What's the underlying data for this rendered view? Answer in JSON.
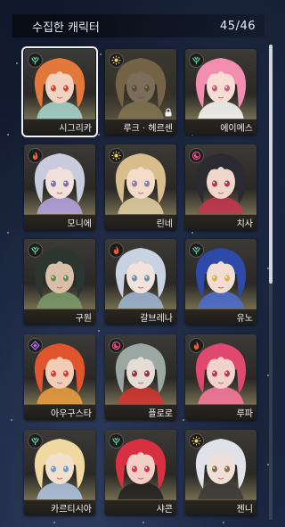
{
  "header": {
    "title": "수집한 캐릭터",
    "count": "45/46"
  },
  "characters": [
    {
      "name": "시그리카",
      "element": "wind",
      "hair": "#e4773a",
      "skin": "#f3d3c0",
      "eyes": "#c34a3a",
      "accent": "#a8d8d0",
      "selected": true,
      "locked": false
    },
    {
      "name": "루크 · 헤르센",
      "element": "light",
      "hair": "#b89a5f",
      "skin": "#c8b08f",
      "eyes": "#7c6a3c",
      "accent": "#d8c27a",
      "selected": false,
      "locked": true
    },
    {
      "name": "에이메스",
      "element": "wind",
      "hair": "#f28fb0",
      "skin": "#f6dcd2",
      "eyes": "#c85a7c",
      "accent": "#ffffff",
      "selected": false,
      "locked": false
    },
    {
      "name": "모니에",
      "element": "fire",
      "hair": "#c8ccdc",
      "skin": "#f2e0da",
      "eyes": "#7f6fa8",
      "accent": "#b7a6e6",
      "selected": false,
      "locked": false
    },
    {
      "name": "린네",
      "element": "light",
      "hair": "#d9bd8c",
      "skin": "#f3dcc8",
      "eyes": "#8a7ea8",
      "accent": "#e6d3a5",
      "selected": false,
      "locked": false
    },
    {
      "name": "치사",
      "element": "dark",
      "hair": "#2b2a30",
      "skin": "#efd7cc",
      "eyes": "#b8344c",
      "accent": "#c7344f",
      "selected": false,
      "locked": false
    },
    {
      "name": "구원",
      "element": "wind",
      "hair": "#2d3530",
      "skin": "#d8c0a8",
      "eyes": "#6b8a54",
      "accent": "#7c9a6a",
      "selected": false,
      "locked": false
    },
    {
      "name": "갈브레나",
      "element": "fire",
      "hair": "#c9d2e0",
      "skin": "#f1e3dc",
      "eyes": "#6d8fb2",
      "accent": "#9fb9d6",
      "selected": false,
      "locked": false
    },
    {
      "name": "유노",
      "element": "wind",
      "hair": "#2d4aa8",
      "skin": "#f2ddd3",
      "eyes": "#d9b24a",
      "accent": "#4d6ed4",
      "selected": false,
      "locked": false
    },
    {
      "name": "아우구스타",
      "element": "chaos",
      "hair": "#e0552e",
      "skin": "#f1cdb8",
      "eyes": "#d04030",
      "accent": "#f0a040",
      "selected": false,
      "locked": false
    },
    {
      "name": "플로로",
      "element": "dark",
      "hair": "#9aa7a2",
      "skin": "#e6dcd6",
      "eyes": "#9c3040",
      "accent": "#d6342e",
      "selected": false,
      "locked": false
    },
    {
      "name": "루파",
      "element": "fire",
      "hair": "#e04870",
      "skin": "#f1d3cc",
      "eyes": "#c83050",
      "accent": "#ff7aa0",
      "selected": false,
      "locked": false
    },
    {
      "name": "카르티시아",
      "element": "wind",
      "hair": "#f0d9a0",
      "skin": "#f3e0cc",
      "eyes": "#6a9ac8",
      "accent": "#b0c8e8",
      "selected": false,
      "locked": false
    },
    {
      "name": "샤콘",
      "element": "wind",
      "hair": "#d83040",
      "skin": "#f1cfc6",
      "eyes": "#d03848",
      "accent": "#202020",
      "selected": false,
      "locked": false
    },
    {
      "name": "젠니",
      "element": "light",
      "hair": "#dfe2e8",
      "skin": "#eee0d8",
      "eyes": "#8a6a4a",
      "accent": "#3a3a3a",
      "selected": false,
      "locked": false
    }
  ],
  "element_colors": {
    "wind": "#5fd6a0",
    "light": "#f2d45a",
    "fire": "#f25a3c",
    "dark": "#e0508a",
    "chaos": "#b06ae8"
  }
}
